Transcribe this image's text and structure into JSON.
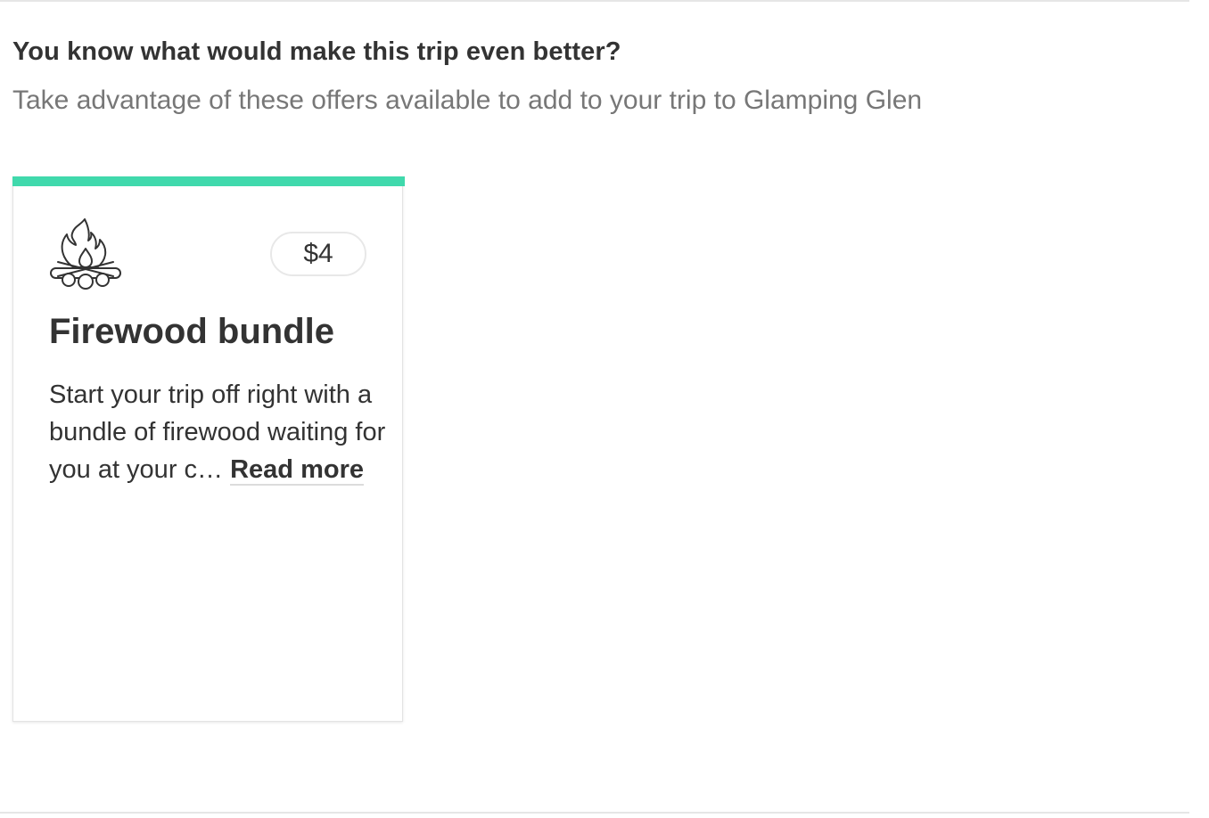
{
  "section": {
    "heading": "You know what would make this trip even better?",
    "subheading": "Take advantage of these offers available to add to your trip to Glamping Glen"
  },
  "offers": [
    {
      "icon": "campfire-icon",
      "price": "$4",
      "title": "Firewood bundle",
      "description": "Start your trip off right with a bundle of firewood waiting for you at your c…",
      "read_more_label": "Read more"
    }
  ],
  "colors": {
    "accent": "#40d9ac",
    "text": "#333333",
    "muted_text": "#777777",
    "divider": "#e6e6e6"
  }
}
